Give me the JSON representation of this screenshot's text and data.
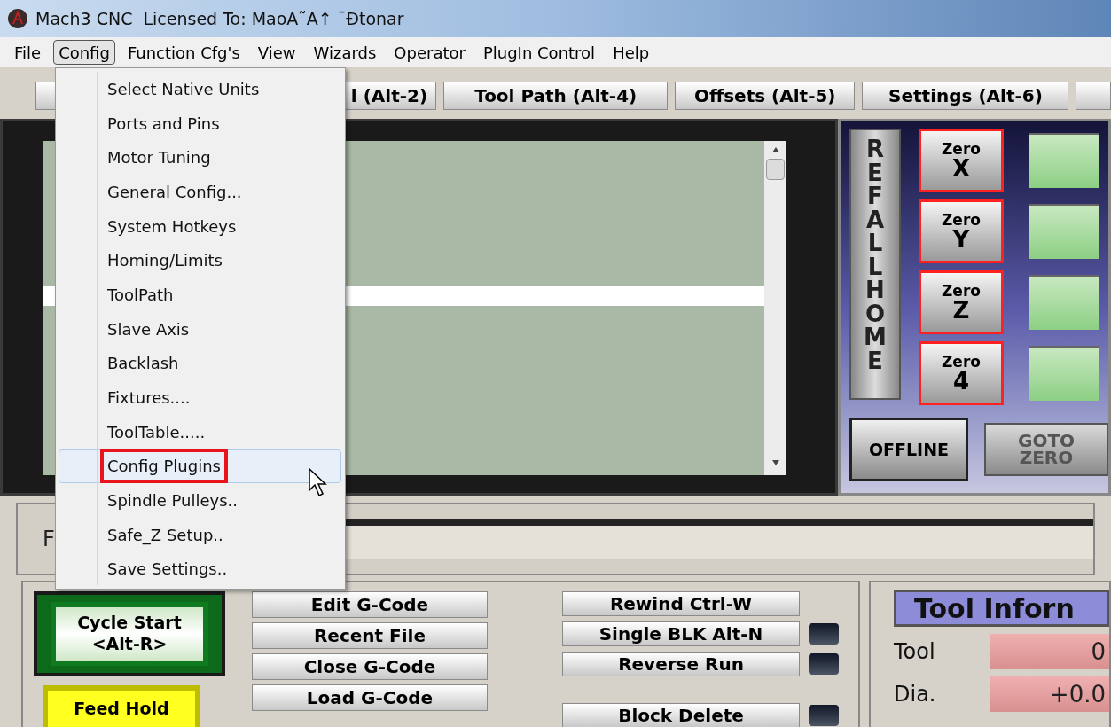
{
  "window": {
    "title": "Mach3 CNC  Licensed To: MaoA˜A↑ ¯Ðtonar"
  },
  "menu_bar": [
    {
      "label": "File",
      "selected": false
    },
    {
      "label": "Config",
      "selected": true
    },
    {
      "label": "Function Cfg's",
      "selected": false
    },
    {
      "label": "View",
      "selected": false
    },
    {
      "label": "Wizards",
      "selected": false
    },
    {
      "label": "Operator",
      "selected": false
    },
    {
      "label": "PlugIn Control",
      "selected": false
    },
    {
      "label": "Help",
      "selected": false
    }
  ],
  "config_menu": [
    {
      "label": "Select Native Units",
      "selected": false,
      "marked": false
    },
    {
      "label": "Ports and Pins",
      "selected": false,
      "marked": false
    },
    {
      "label": "Motor Tuning",
      "selected": false,
      "marked": false
    },
    {
      "label": "General Config...",
      "selected": false,
      "marked": false
    },
    {
      "label": "System Hotkeys",
      "selected": false,
      "marked": false
    },
    {
      "label": "Homing/Limits",
      "selected": false,
      "marked": false
    },
    {
      "label": "ToolPath",
      "selected": false,
      "marked": false
    },
    {
      "label": "Slave Axis",
      "selected": false,
      "marked": false
    },
    {
      "label": "Backlash",
      "selected": false,
      "marked": false
    },
    {
      "label": "Fixtures....",
      "selected": false,
      "marked": false
    },
    {
      "label": "ToolTable.....",
      "selected": false,
      "marked": false
    },
    {
      "label": "Config Plugins",
      "selected": true,
      "marked": true
    },
    {
      "label": "Spindle Pulleys..",
      "selected": false,
      "marked": false
    },
    {
      "label": "Safe_Z Setup..",
      "selected": false,
      "marked": false
    },
    {
      "label": "Save Settings..",
      "selected": false,
      "marked": false
    }
  ],
  "tabs": [
    {
      "label": "l (Alt-2)"
    },
    {
      "label": "Tool Path (Alt-4)"
    },
    {
      "label": "Offsets (Alt-5)"
    },
    {
      "label": "Settings (Alt-6)"
    }
  ],
  "dro": {
    "ref_all_home": "REF ALL HOME",
    "zero_buttons": [
      {
        "top": "Zero",
        "axis": "X"
      },
      {
        "top": "Zero",
        "axis": "Y"
      },
      {
        "top": "Zero",
        "axis": "Z"
      },
      {
        "top": "Zero",
        "axis": "4"
      }
    ],
    "offline": "OFFLINE",
    "goto_zero": "GOTO ZERO"
  },
  "file_label": "F",
  "cycle_start": {
    "line1": "Cycle Start",
    "line2": "<Alt-R>"
  },
  "feed_hold": "Feed Hold",
  "program_buttons": [
    "Edit G-Code",
    "Recent File",
    "Close G-Code",
    "Load G-Code"
  ],
  "run_buttons": [
    {
      "label": "Rewind Ctrl-W",
      "kind": "plain"
    },
    {
      "label": "Single BLK Alt-N",
      "kind": "led"
    },
    {
      "label": "Reverse Run",
      "kind": "led"
    },
    {
      "label": "Block Delete",
      "kind": "led"
    }
  ],
  "tool_info": {
    "title": "Tool Inforn",
    "fields": [
      {
        "label": "Tool",
        "value": "0"
      },
      {
        "label": "Dia.",
        "value": "+0.0"
      }
    ]
  }
}
